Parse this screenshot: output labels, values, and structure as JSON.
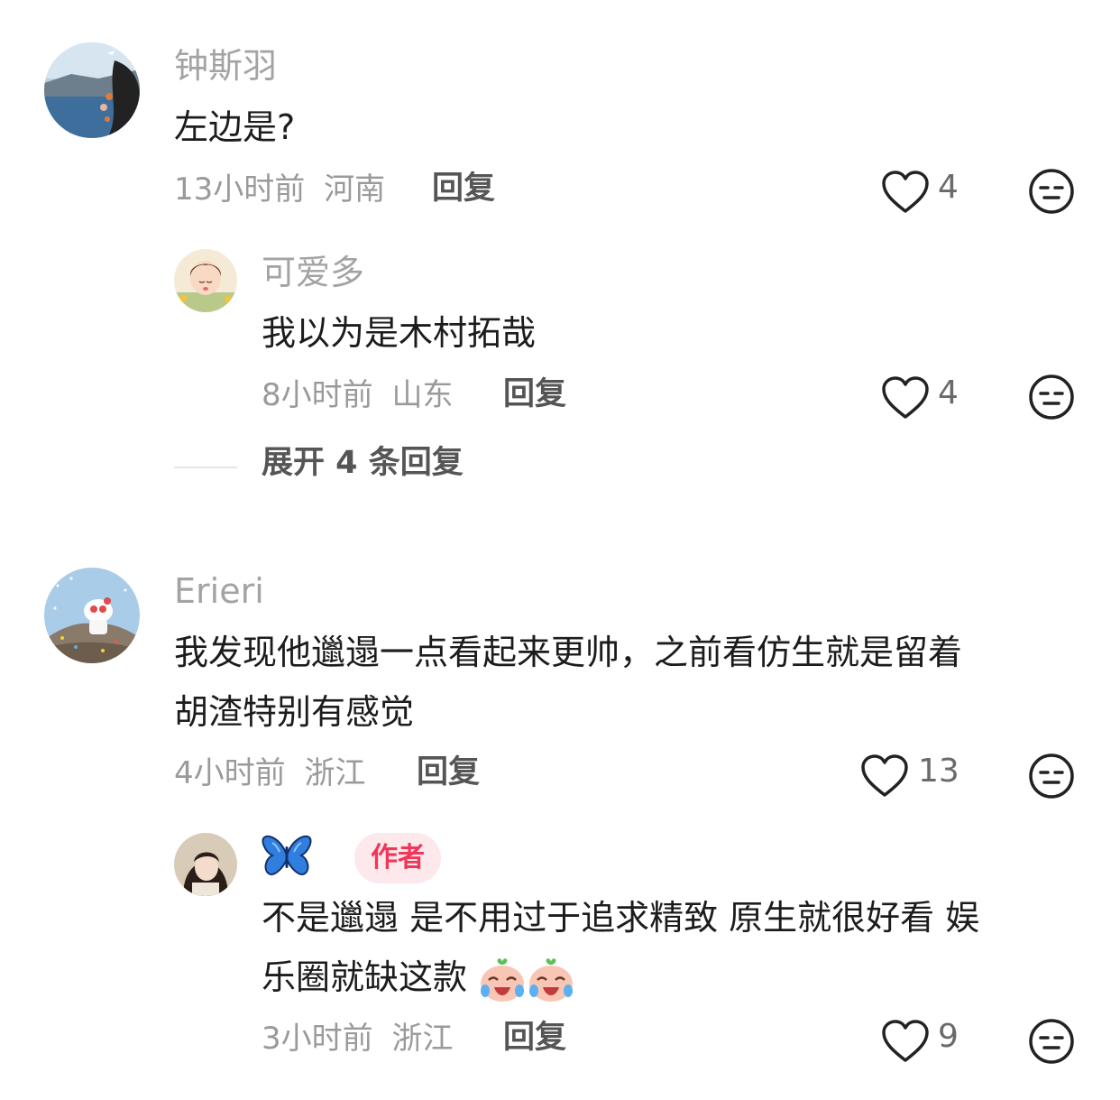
{
  "comments": [
    {
      "username": "钟斯羽",
      "text": "左边是?",
      "time": "13小时前",
      "location": "河南",
      "reply_label": "回复",
      "likes": "4",
      "replies": [
        {
          "username": "可爱多",
          "text": "我以为是木村拓哉",
          "time": "8小时前",
          "location": "山东",
          "reply_label": "回复",
          "likes": "4"
        }
      ],
      "expand_label": "展开 4 条回复"
    },
    {
      "username": "Erieri",
      "text_line1": "我发现他邋遢一点看起来更帅，之前看仿生就是留着",
      "text_line2": "胡渣特别有感觉",
      "time": "4小时前",
      "location": "浙江",
      "reply_label": "回复",
      "likes": "13",
      "replies": [
        {
          "username_icon": "butterfly-emoji",
          "author_badge": "作者",
          "text_line1": "不是邋遢 是不用过于追求精致 原生就很好看 娱",
          "text_line2": "乐圈就缺这款",
          "emojis": [
            "crying-laughing-face",
            "crying-laughing-face"
          ],
          "time": "3小时前",
          "location": "浙江",
          "reply_label": "回复",
          "likes": "9"
        }
      ]
    }
  ],
  "icons": {
    "like": "heart-outline-icon",
    "dislike": "expressionless-face-icon"
  },
  "colors": {
    "username": "#a3a3a3",
    "text": "#1c1c1c",
    "meta": "#9a9a9a",
    "badge_bg": "#fde8ec",
    "badge_text": "#f0365a"
  }
}
